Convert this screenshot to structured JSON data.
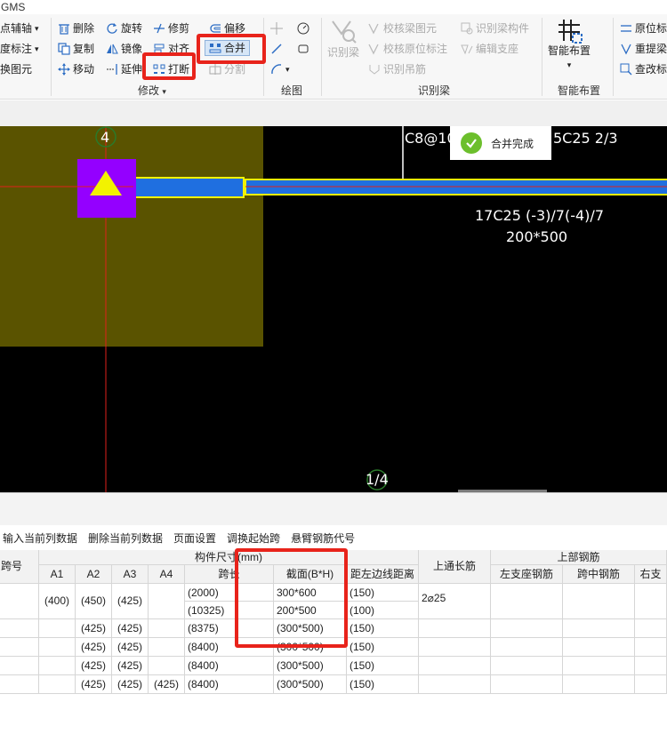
{
  "app": {
    "title": "GMS"
  },
  "ribbon": {
    "col0": [
      "点辅轴",
      "度标注",
      "换图元"
    ],
    "modify": {
      "delete": "删除",
      "rotate": "旋转",
      "trim": "修剪",
      "offset": "偏移",
      "copy": "复制",
      "mirror": "镜像",
      "align": "对齐",
      "merge": "合并",
      "move": "移动",
      "extend": "延伸",
      "break": "打断",
      "split": "分割",
      "group_label": "修改"
    },
    "draw": {
      "group_label": "绘图"
    },
    "identify": {
      "identify_beam": "识别梁",
      "check_beam_elements": "校核梁图元",
      "identify_beam_members": "识别梁构件",
      "check_original_annotation": "校核原位标注",
      "edit_support": "编辑支座",
      "identify_hanger_bars": "识别吊筋",
      "group_label": "识别梁"
    },
    "smart": {
      "smart_layout": "智能布置",
      "group_label": "智能布置"
    },
    "right": {
      "in_place_annot": "原位标",
      "re_extract": "重提梁",
      "view_modify": "查改标"
    }
  },
  "toast": {
    "message": "合并完成"
  },
  "canvas": {
    "axis_top": "4",
    "axis_bottom": "1/4",
    "annot_top_left": "C8@10",
    "annot_top_right": "5C25 2/3",
    "annot_bottom_line1": "17C25 (-3)/7(-4)/7",
    "annot_bottom_line2": "200*500",
    "colors": {
      "background": "#000000",
      "column": "#5a5300",
      "support": "#9400ff",
      "beam": "#1f6fe0",
      "beam_outline": "#f2f200",
      "axis": "#e0201a"
    }
  },
  "table_toolbar": [
    "输入当前列数据",
    "删除当前列数据",
    "页面设置",
    "调换起始跨",
    "悬臂钢筋代号"
  ],
  "table": {
    "headers": {
      "span_no": "跨号",
      "member_size": "构件尺寸(mm)",
      "a1": "A1",
      "a2": "A2",
      "a3": "A3",
      "a4": "A4",
      "span_length": "跨长",
      "section": "截面(B*H)",
      "edge_dist": "距左边线距离",
      "top_through": "上通长筋",
      "top_rebar": "上部钢筋",
      "left_support": "左支座钢筋",
      "mid_span": "跨中钢筋",
      "right_support": "右支"
    },
    "row1": {
      "a1": "(400)",
      "a2": "(450)",
      "a3": "(425)",
      "sub": [
        {
          "span": "(2000)",
          "section": "300*600",
          "dist": "(150)"
        },
        {
          "span": "(10325)",
          "section": "200*500",
          "dist": "(100)"
        }
      ],
      "top_through": "2⌀25"
    },
    "rows": [
      {
        "a2": "(425)",
        "a3": "(425)",
        "a4": "",
        "span": "(8375)",
        "section": "(300*500)",
        "dist": "(150)"
      },
      {
        "a2": "(425)",
        "a3": "(425)",
        "a4": "",
        "span": "(8400)",
        "section": "(300*500)",
        "dist": "(150)"
      },
      {
        "a2": "(425)",
        "a3": "(425)",
        "a4": "",
        "span": "(8400)",
        "section": "(300*500)",
        "dist": "(150)"
      },
      {
        "a2": "(425)",
        "a3": "(425)",
        "a4": "(425)",
        "span": "(8400)",
        "section": "(300*500)",
        "dist": "(150)"
      }
    ]
  }
}
